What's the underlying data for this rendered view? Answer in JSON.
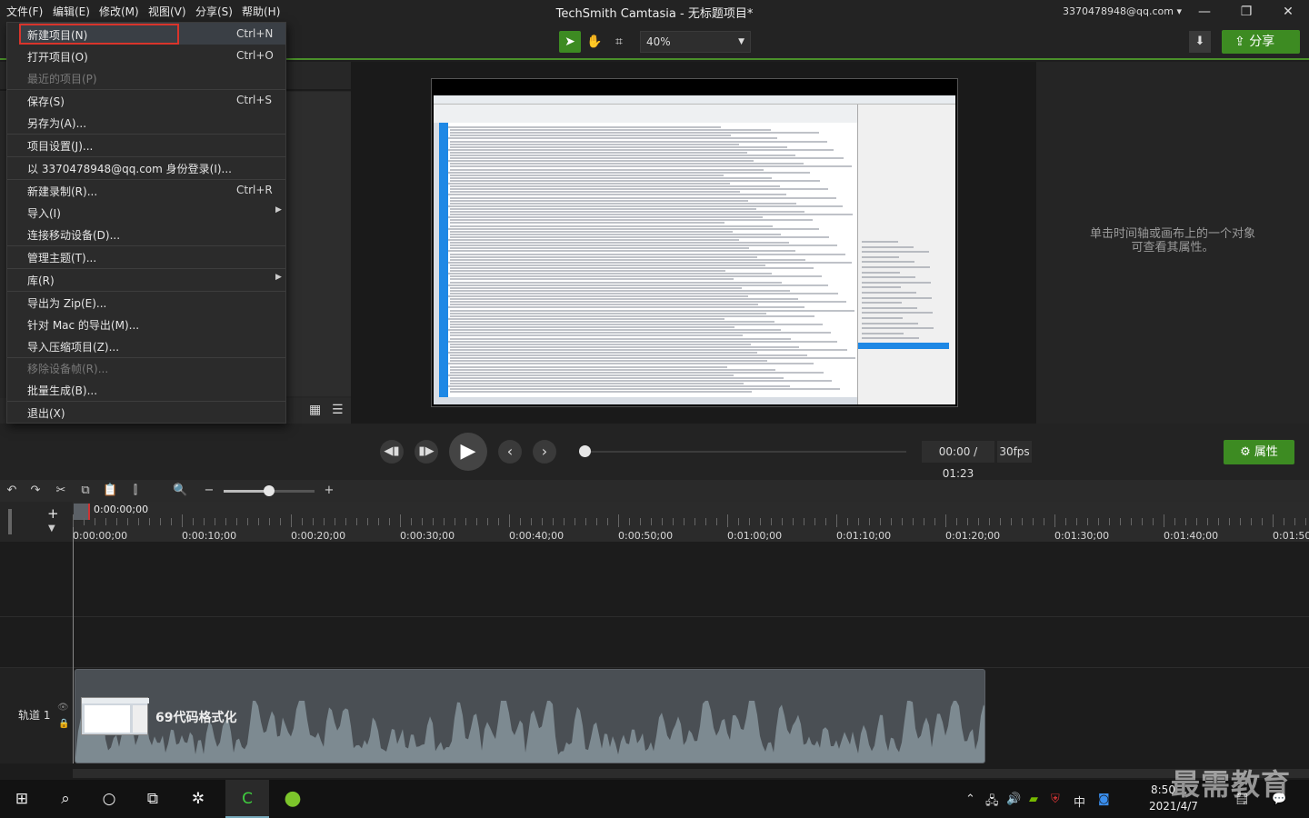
{
  "menubar": [
    "文件(F)",
    "编辑(E)",
    "修改(M)",
    "视图(V)",
    "分享(S)",
    "帮助(H)"
  ],
  "app_title": "TechSmith Camtasia - 无标题项目*",
  "account": "3370478948@qq.com",
  "toolbar": {
    "zoom": "40%",
    "share_label": "分享"
  },
  "file_menu": {
    "items": [
      {
        "label": "新建项目(N)",
        "shortcut": "Ctrl+N"
      },
      {
        "label": "打开项目(O)",
        "shortcut": "Ctrl+O"
      },
      {
        "label": "最近的项目(P)",
        "shortcut": ""
      },
      {
        "label": "保存(S)",
        "shortcut": "Ctrl+S"
      },
      {
        "label": "另存为(A)...",
        "shortcut": ""
      },
      {
        "label": "项目设置(J)...",
        "shortcut": ""
      },
      {
        "label": "以 3370478948@qq.com 身份登录(I)...",
        "shortcut": ""
      },
      {
        "label": "新建录制(R)...",
        "shortcut": "Ctrl+R"
      },
      {
        "label": "导入(I)",
        "shortcut": ""
      },
      {
        "label": "连接移动设备(D)...",
        "shortcut": ""
      },
      {
        "label": "管理主题(T)...",
        "shortcut": ""
      },
      {
        "label": "库(R)",
        "shortcut": ""
      },
      {
        "label": "导出为 Zip(E)...",
        "shortcut": ""
      },
      {
        "label": "针对 Mac 的导出(M)...",
        "shortcut": ""
      },
      {
        "label": "导入压缩项目(Z)...",
        "shortcut": ""
      },
      {
        "label": "移除设备帧(R)...",
        "shortcut": ""
      },
      {
        "label": "批量生成(B)...",
        "shortcut": ""
      },
      {
        "label": "退出(X)",
        "shortcut": ""
      }
    ]
  },
  "properties_hint_line1": "单击时间轴或画布上的一个对象",
  "properties_hint_line2": "可查看其属性。",
  "playback": {
    "time": "00:00 / 01:23",
    "fps": "30fps",
    "properties_label": "属性"
  },
  "timeline": {
    "playhead": "0:00:00;00",
    "ruler": [
      "0:00:00;00",
      "0:00:10;00",
      "0:00:20;00",
      "0:00:30;00",
      "0:00:40;00",
      "0:00:50;00",
      "0:01:00;00",
      "0:01:10;00",
      "0:01:20;00",
      "0:01:30;00",
      "0:01:40;00",
      "0:01:50;"
    ],
    "track_name": "轨道 1",
    "clip_title": "69代码格式化"
  },
  "taskbar": {
    "time": "8:50",
    "date": "2021/4/7",
    "ime": "中"
  },
  "watermark": "最需教育",
  "colors": {
    "accent_green": "#3d8b22",
    "highlight_red": "#d9342b",
    "toolbar_border": "#4a8f2a"
  }
}
